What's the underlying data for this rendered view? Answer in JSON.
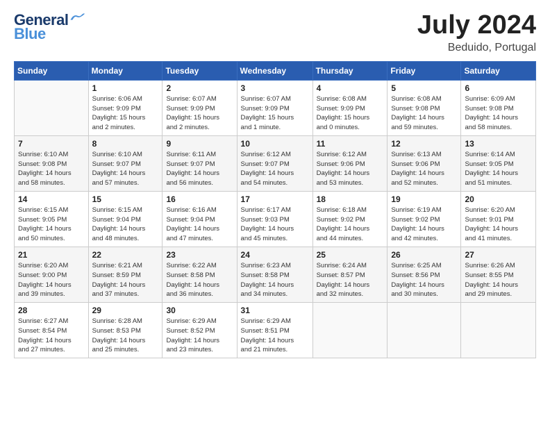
{
  "header": {
    "logo": {
      "line1": "General",
      "line2": "Blue",
      "bird_color": "#4a90d9"
    },
    "month": "July 2024",
    "location": "Beduido, Portugal"
  },
  "weekdays": [
    "Sunday",
    "Monday",
    "Tuesday",
    "Wednesday",
    "Thursday",
    "Friday",
    "Saturday"
  ],
  "weeks": [
    [
      {
        "day": "",
        "info": ""
      },
      {
        "day": "1",
        "info": "Sunrise: 6:06 AM\nSunset: 9:09 PM\nDaylight: 15 hours\nand 2 minutes."
      },
      {
        "day": "2",
        "info": "Sunrise: 6:07 AM\nSunset: 9:09 PM\nDaylight: 15 hours\nand 2 minutes."
      },
      {
        "day": "3",
        "info": "Sunrise: 6:07 AM\nSunset: 9:09 PM\nDaylight: 15 hours\nand 1 minute."
      },
      {
        "day": "4",
        "info": "Sunrise: 6:08 AM\nSunset: 9:09 PM\nDaylight: 15 hours\nand 0 minutes."
      },
      {
        "day": "5",
        "info": "Sunrise: 6:08 AM\nSunset: 9:08 PM\nDaylight: 14 hours\nand 59 minutes."
      },
      {
        "day": "6",
        "info": "Sunrise: 6:09 AM\nSunset: 9:08 PM\nDaylight: 14 hours\nand 58 minutes."
      }
    ],
    [
      {
        "day": "7",
        "info": "Sunrise: 6:10 AM\nSunset: 9:08 PM\nDaylight: 14 hours\nand 58 minutes."
      },
      {
        "day": "8",
        "info": "Sunrise: 6:10 AM\nSunset: 9:07 PM\nDaylight: 14 hours\nand 57 minutes."
      },
      {
        "day": "9",
        "info": "Sunrise: 6:11 AM\nSunset: 9:07 PM\nDaylight: 14 hours\nand 56 minutes."
      },
      {
        "day": "10",
        "info": "Sunrise: 6:12 AM\nSunset: 9:07 PM\nDaylight: 14 hours\nand 54 minutes."
      },
      {
        "day": "11",
        "info": "Sunrise: 6:12 AM\nSunset: 9:06 PM\nDaylight: 14 hours\nand 53 minutes."
      },
      {
        "day": "12",
        "info": "Sunrise: 6:13 AM\nSunset: 9:06 PM\nDaylight: 14 hours\nand 52 minutes."
      },
      {
        "day": "13",
        "info": "Sunrise: 6:14 AM\nSunset: 9:05 PM\nDaylight: 14 hours\nand 51 minutes."
      }
    ],
    [
      {
        "day": "14",
        "info": "Sunrise: 6:15 AM\nSunset: 9:05 PM\nDaylight: 14 hours\nand 50 minutes."
      },
      {
        "day": "15",
        "info": "Sunrise: 6:15 AM\nSunset: 9:04 PM\nDaylight: 14 hours\nand 48 minutes."
      },
      {
        "day": "16",
        "info": "Sunrise: 6:16 AM\nSunset: 9:04 PM\nDaylight: 14 hours\nand 47 minutes."
      },
      {
        "day": "17",
        "info": "Sunrise: 6:17 AM\nSunset: 9:03 PM\nDaylight: 14 hours\nand 45 minutes."
      },
      {
        "day": "18",
        "info": "Sunrise: 6:18 AM\nSunset: 9:02 PM\nDaylight: 14 hours\nand 44 minutes."
      },
      {
        "day": "19",
        "info": "Sunrise: 6:19 AM\nSunset: 9:02 PM\nDaylight: 14 hours\nand 42 minutes."
      },
      {
        "day": "20",
        "info": "Sunrise: 6:20 AM\nSunset: 9:01 PM\nDaylight: 14 hours\nand 41 minutes."
      }
    ],
    [
      {
        "day": "21",
        "info": "Sunrise: 6:20 AM\nSunset: 9:00 PM\nDaylight: 14 hours\nand 39 minutes."
      },
      {
        "day": "22",
        "info": "Sunrise: 6:21 AM\nSunset: 8:59 PM\nDaylight: 14 hours\nand 37 minutes."
      },
      {
        "day": "23",
        "info": "Sunrise: 6:22 AM\nSunset: 8:58 PM\nDaylight: 14 hours\nand 36 minutes."
      },
      {
        "day": "24",
        "info": "Sunrise: 6:23 AM\nSunset: 8:58 PM\nDaylight: 14 hours\nand 34 minutes."
      },
      {
        "day": "25",
        "info": "Sunrise: 6:24 AM\nSunset: 8:57 PM\nDaylight: 14 hours\nand 32 minutes."
      },
      {
        "day": "26",
        "info": "Sunrise: 6:25 AM\nSunset: 8:56 PM\nDaylight: 14 hours\nand 30 minutes."
      },
      {
        "day": "27",
        "info": "Sunrise: 6:26 AM\nSunset: 8:55 PM\nDaylight: 14 hours\nand 29 minutes."
      }
    ],
    [
      {
        "day": "28",
        "info": "Sunrise: 6:27 AM\nSunset: 8:54 PM\nDaylight: 14 hours\nand 27 minutes."
      },
      {
        "day": "29",
        "info": "Sunrise: 6:28 AM\nSunset: 8:53 PM\nDaylight: 14 hours\nand 25 minutes."
      },
      {
        "day": "30",
        "info": "Sunrise: 6:29 AM\nSunset: 8:52 PM\nDaylight: 14 hours\nand 23 minutes."
      },
      {
        "day": "31",
        "info": "Sunrise: 6:29 AM\nSunset: 8:51 PM\nDaylight: 14 hours\nand 21 minutes."
      },
      {
        "day": "",
        "info": ""
      },
      {
        "day": "",
        "info": ""
      },
      {
        "day": "",
        "info": ""
      }
    ]
  ]
}
